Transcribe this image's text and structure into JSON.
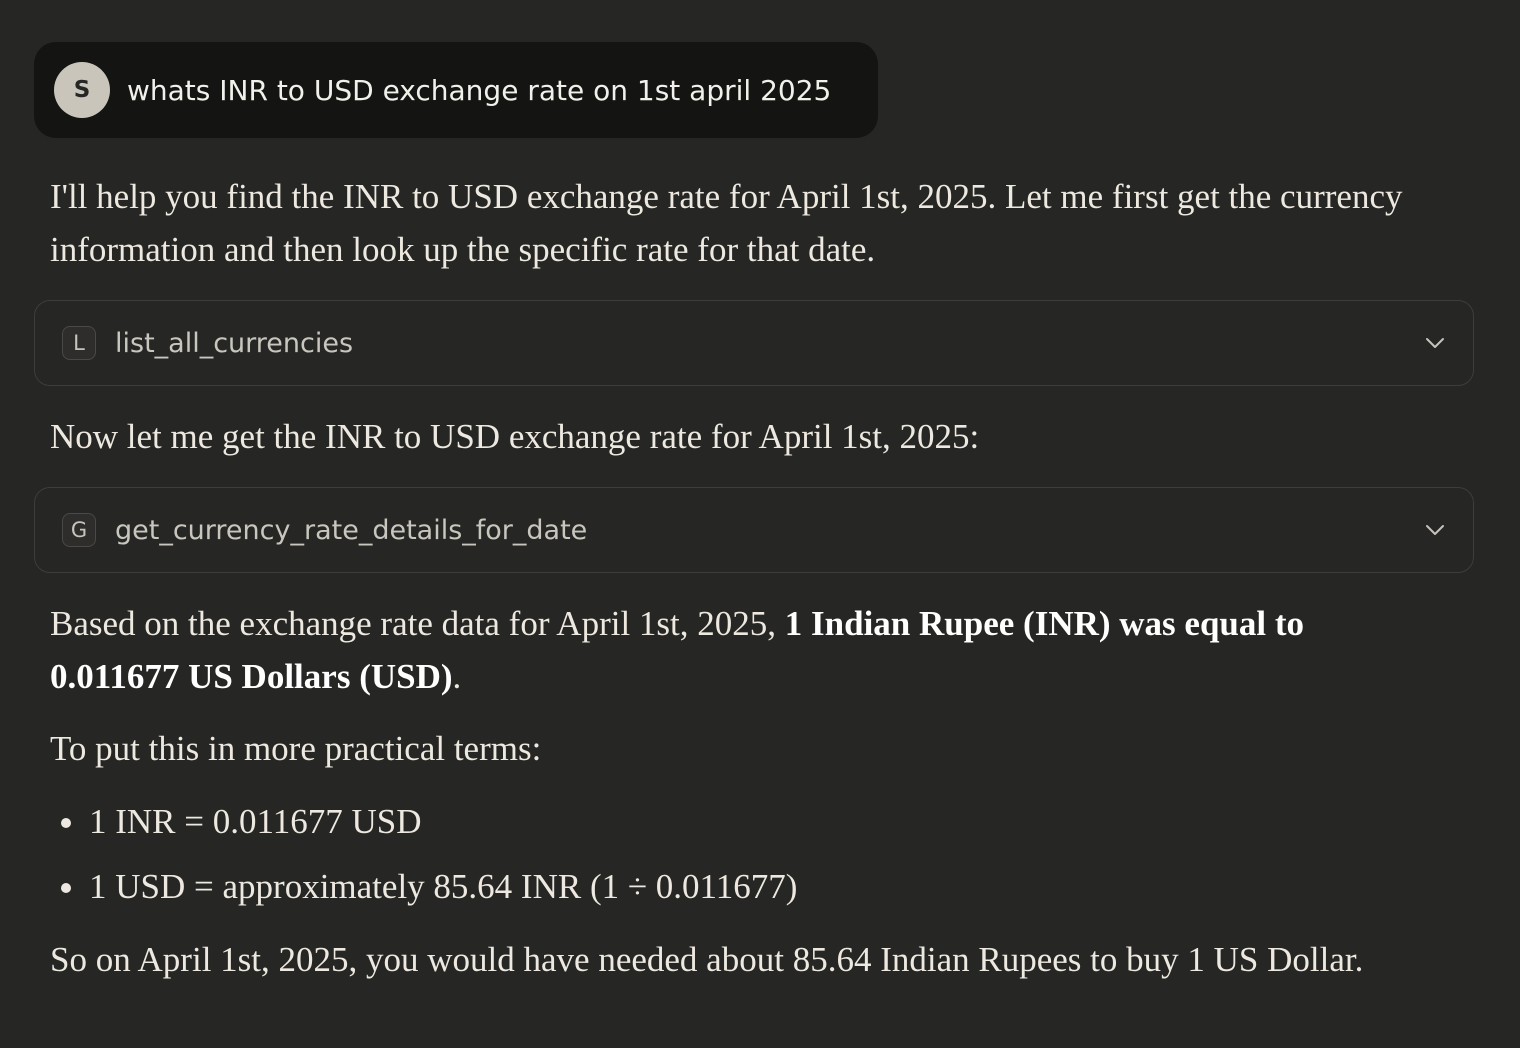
{
  "user_message": {
    "avatar_initial": "S",
    "text": "whats INR to USD exchange rate on 1st april 2025"
  },
  "assistant": {
    "intro_line1": "I'll help you find the INR to USD exchange rate for April 1st, 2025. Let me first get the currency",
    "intro_line2": "information and then look up the specific rate for that date.",
    "tool1": {
      "letter": "L",
      "name": "list_all_currencies",
      "icon": "chevron-down-icon"
    },
    "followup": "Now let me get the INR to USD exchange rate for April 1st, 2025:",
    "tool2": {
      "letter": "G",
      "name": "get_currency_rate_details_for_date",
      "icon": "chevron-down-icon"
    },
    "answer_prefix": "Based on the exchange rate data for April 1st, 2025, ",
    "answer_bold_line1": "1 Indian Rupee (INR) was equal to",
    "answer_bold_line2": "0.011677 US Dollars (USD)",
    "answer_suffix": ".",
    "practical_intro": "To put this in more practical terms:",
    "bullets": [
      "1 INR = 0.011677 USD",
      "1 USD = approximately 85.64 INR (1 ÷ 0.011677)"
    ],
    "conclusion": "So on April 1st, 2025, you would have needed about 85.64 Indian Rupees to buy 1 US Dollar."
  },
  "colors": {
    "background": "#262624",
    "user_bubble": "#141413",
    "avatar": "#c9c5ba",
    "card_border": "#3e3d39",
    "text": "#ede9e0"
  }
}
